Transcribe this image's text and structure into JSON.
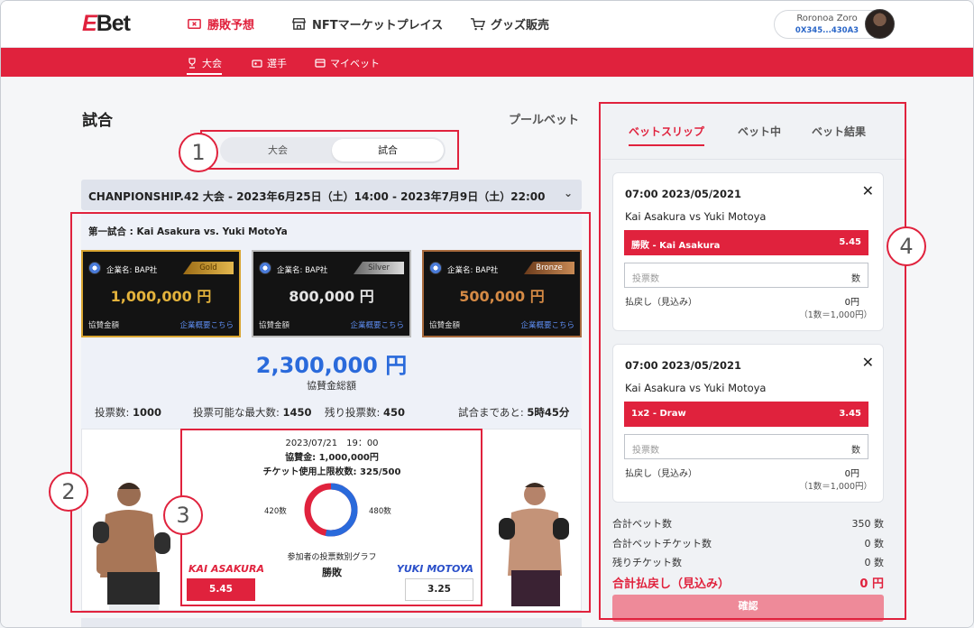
{
  "header": {
    "logo_mark": "E",
    "logo_text": "Bet",
    "nav": [
      {
        "label": "勝敗予想",
        "icon": "ticket-icon"
      },
      {
        "label": "NFTマーケットプレイス",
        "icon": "store-icon"
      },
      {
        "label": "グッズ販売",
        "icon": "cart-icon"
      }
    ],
    "user": {
      "name": "Roronoa Zoro",
      "address": "0X345...430A3"
    }
  },
  "subnav": [
    {
      "label": "大会",
      "icon": "trophy-icon"
    },
    {
      "label": "選手",
      "icon": "card-icon"
    },
    {
      "label": "マイベット",
      "icon": "wallet-icon"
    }
  ],
  "main": {
    "title": "試合",
    "pool_bet": "プールベット",
    "toggle": [
      "大会",
      "試合"
    ],
    "championship": "CHANPIONSHIP.42 大会 - 2023年6月25日（土）14:00 - 2023年7月9日（土）22:00",
    "match_title": "第一試合 : Kai Asakura vs. Yuki MotoYa",
    "sponsors": [
      {
        "company": "企業名: BAP社",
        "tier": "Gold",
        "amount": "1,000,000 円",
        "label": "協賛金額",
        "link": "企業概要こちら"
      },
      {
        "company": "企業名: BAP社",
        "tier": "Silver",
        "amount": "800,000 円",
        "label": "協賛金額",
        "link": "企業概要こちら"
      },
      {
        "company": "企業名: BAP社",
        "tier": "Bronze",
        "amount": "500,000 円",
        "label": "協賛金額",
        "link": "企業概要こちら"
      }
    ],
    "total_amount": "2,300,000 円",
    "total_label": "協賛金総額",
    "stats": [
      {
        "label": "投票数: ",
        "value": "1000"
      },
      {
        "label": "投票可能な最大数: ",
        "value": "1450"
      },
      {
        "label": "残り投票数: ",
        "value": "450"
      },
      {
        "label": "試合まであと: ",
        "value": "5時45分"
      }
    ],
    "fight": {
      "datetime": "2023/07/21　19：00",
      "sponsor": "協賛金: 1,000,000円",
      "ticket_limit": "チケット使用上限枚数: 325/500",
      "left_votes": "420数",
      "right_votes": "480数",
      "left_vote_count": 420,
      "right_vote_count": 480,
      "graph_label": "参加者の投票数別グラフ",
      "result_label": "勝敗",
      "left_name": "KAI ASAKURA",
      "right_name": "YUKI MOTOYA",
      "left_odds": "5.45",
      "right_odds": "3.25",
      "left_color": "#e0223d",
      "right_color": "#2a6adb"
    }
  },
  "slip": {
    "tabs": [
      "ベットスリップ",
      "ベット中",
      "ベット結果"
    ],
    "bets": [
      {
        "datetime": "07:00  2023/05/2021",
        "match": "Kai Asakura vs Yuki Motoya",
        "selection": "勝敗 - Kai Asakura",
        "odds": "5.45",
        "placeholder": "投票数",
        "unit": "数",
        "return_label": "払戻し（見込み）",
        "return_value": "0円",
        "rate": "（1数＝1,000円）"
      },
      {
        "datetime": "07:00  2023/05/2021",
        "match": "Kai Asakura vs Yuki Motoya",
        "selection": "1x2 - Draw",
        "odds": "3.45",
        "placeholder": "投票数",
        "unit": "数",
        "return_label": "払戻し（見込み）",
        "return_value": "0円",
        "rate": "（1数＝1,000円）"
      }
    ],
    "summary": [
      {
        "label": "合計ベット数",
        "value": "350 数"
      },
      {
        "label": "合計ベットチケット数",
        "value": "0 数"
      },
      {
        "label": "残りチケット数",
        "value": "0 数"
      }
    ],
    "total_return_label": "合計払戻し（見込み）",
    "total_return_value": "0 円",
    "confirm": "確認"
  },
  "annotations": [
    "1",
    "2",
    "3",
    "4"
  ]
}
